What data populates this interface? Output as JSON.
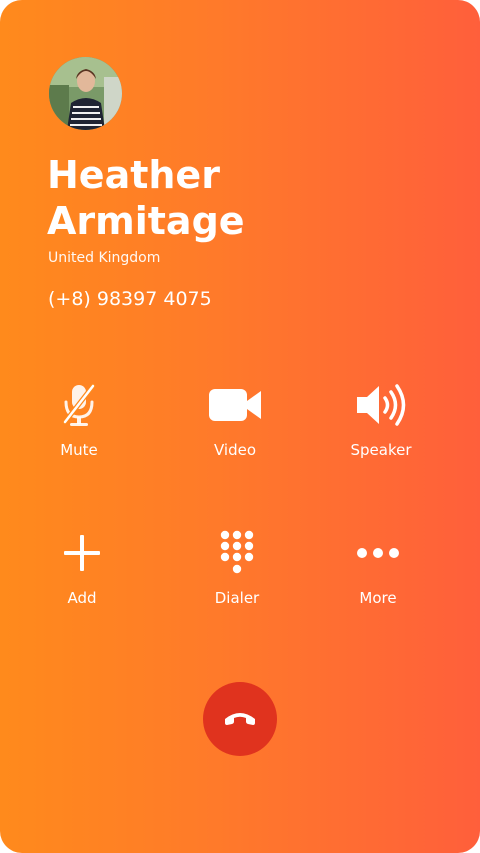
{
  "contact": {
    "name": "Heather Armitage",
    "country": "United Kingdom",
    "phone": "(+8) 98397 4075"
  },
  "actions": [
    {
      "label": "Mute",
      "icon": "mic-off-icon"
    },
    {
      "label": "Video",
      "icon": "video-camera-icon"
    },
    {
      "label": "Speaker",
      "icon": "speaker-icon"
    },
    {
      "label": "Add",
      "icon": "plus-icon"
    },
    {
      "label": "Dialer",
      "icon": "dialpad-icon"
    },
    {
      "label": "More",
      "icon": "more-dots-icon"
    }
  ],
  "end_call": {
    "icon": "hang-up-icon"
  },
  "colors": {
    "background_start": "#ff8a1c",
    "background_end": "#ff5f3b",
    "end_call": "#e0331e",
    "text": "#ffffff"
  }
}
